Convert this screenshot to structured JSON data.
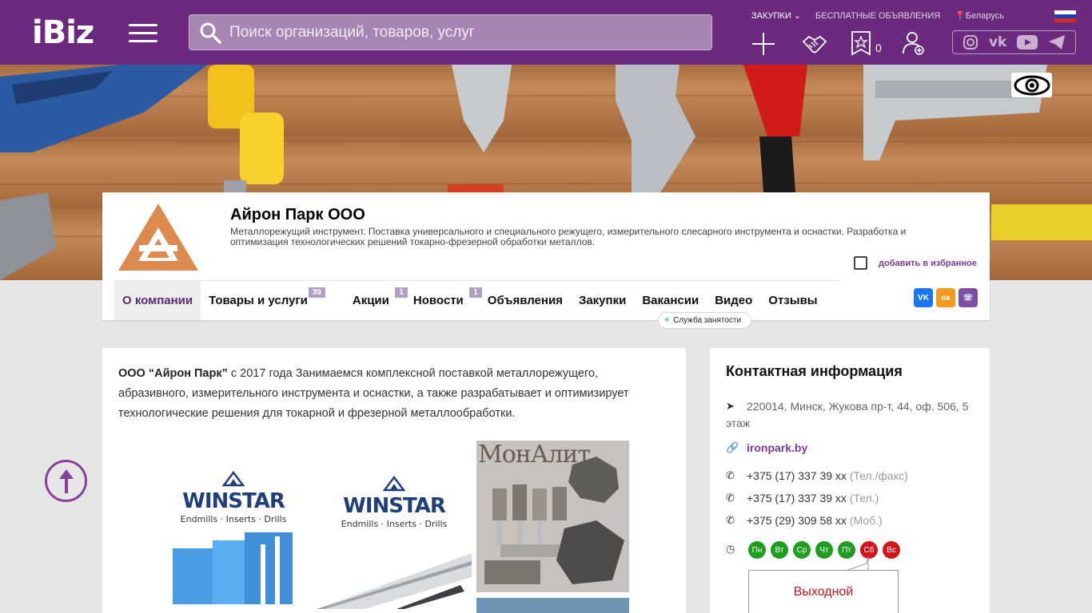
{
  "header": {
    "logo": "iBiz",
    "search_placeholder": "Поиск организаций, товаров, услуг",
    "links": {
      "purchases": "ЗАКУПКИ",
      "free_ads": "БЕСПЛАТНЫЕ ОБЪЯВЛЕНИЯ",
      "region": "Беларусь"
    },
    "favorites_count": "0"
  },
  "company": {
    "name": "Айрон Парк ООО",
    "description": "Металлорежущий инструмент. Поставка универсального и специального режущего, измерительного слесарного инструмента и оснастки. Разработка и оптимизация технологических решений токарно-фрезерной обработки металлов.",
    "add_favorite": "добавить в избранное"
  },
  "nav": {
    "items": [
      {
        "label": "О компании"
      },
      {
        "label": "Товары и услуги",
        "badge": "39"
      },
      {
        "label": "Акции",
        "badge": "1"
      },
      {
        "label": "Новости",
        "badge": "1"
      },
      {
        "label": "Объявления"
      },
      {
        "label": "Закупки"
      },
      {
        "label": "Вакансии"
      },
      {
        "label": "Видео"
      },
      {
        "label": "Отзывы"
      }
    ],
    "callout": "Служба занятости"
  },
  "about": {
    "company_name_bold": "ООО “Айрон Парк”",
    "text": " с 2017 года Занимаемся комплексной поставкой металлорежущего, абразивного, измерительного инструмента и оснастки, а также разрабатывает и оптимизирует технологические решения для токарной и фрезерной металлообработки."
  },
  "products": {
    "winstar_name": "WINSTAR",
    "winstar_tagline": "Endmills · Inserts · Drills",
    "monalit_title": "МонАлит"
  },
  "contacts": {
    "title": "Контактная информация",
    "address": "220014, Минск, Жукова пр-т, 44, оф. 506, 5 этаж",
    "website": "ironpark.by",
    "phones": [
      {
        "number": "+375 (17) 337 39 хх",
        "note": "(Тел./факс)"
      },
      {
        "number": "+375 (17) 337 39 хх",
        "note": "(Тел.)"
      },
      {
        "number": "+375 (29) 309 58 хх",
        "note": "(Моб.)"
      }
    ],
    "days": [
      {
        "label": "Пн",
        "status": "open"
      },
      {
        "label": "Вт",
        "status": "open"
      },
      {
        "label": "Ср",
        "status": "open"
      },
      {
        "label": "Чт",
        "status": "open"
      },
      {
        "label": "Пт",
        "status": "open"
      },
      {
        "label": "Сб",
        "status": "closed"
      },
      {
        "label": "Вс",
        "status": "closed"
      }
    ],
    "today_status": "Выходной"
  },
  "colors": {
    "brand": "#6b2a7d",
    "open_day": "#1e9d1e",
    "closed_day": "#d4141c"
  }
}
